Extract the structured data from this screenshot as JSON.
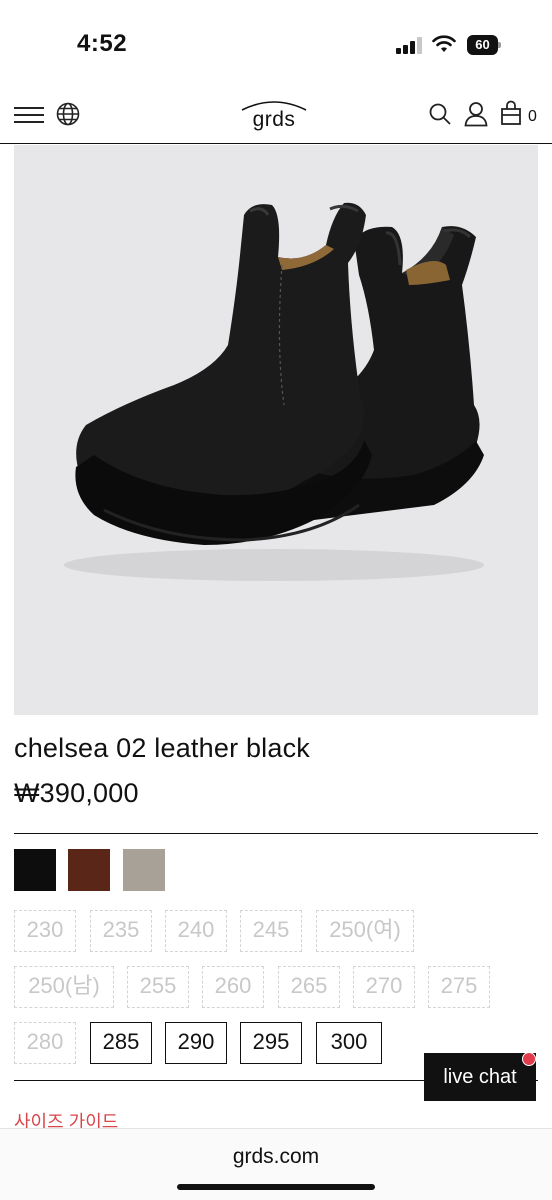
{
  "status": {
    "time": "4:52",
    "battery": "60"
  },
  "nav": {
    "logo": "grds",
    "cart_count": "0"
  },
  "product": {
    "name": "chelsea 02 leather black",
    "price": "₩390,000",
    "colors": [
      "#0d0d0d",
      "#5a2617",
      "#a8a197"
    ]
  },
  "sizes": [
    {
      "label": "230",
      "available": false
    },
    {
      "label": "235",
      "available": false
    },
    {
      "label": "240",
      "available": false
    },
    {
      "label": "245",
      "available": false
    },
    {
      "label": "250(여)",
      "available": false
    },
    {
      "label": "250(남)",
      "available": false
    },
    {
      "label": "255",
      "available": false
    },
    {
      "label": "260",
      "available": false
    },
    {
      "label": "265",
      "available": false
    },
    {
      "label": "270",
      "available": false
    },
    {
      "label": "275",
      "available": false
    },
    {
      "label": "280",
      "available": false
    },
    {
      "label": "285",
      "available": true
    },
    {
      "label": "290",
      "available": true
    },
    {
      "label": "295",
      "available": true
    },
    {
      "label": "300",
      "available": true
    }
  ],
  "size_guide": "사이즈 가이드",
  "live_chat": "live chat",
  "browser": {
    "url": "grds.com"
  }
}
